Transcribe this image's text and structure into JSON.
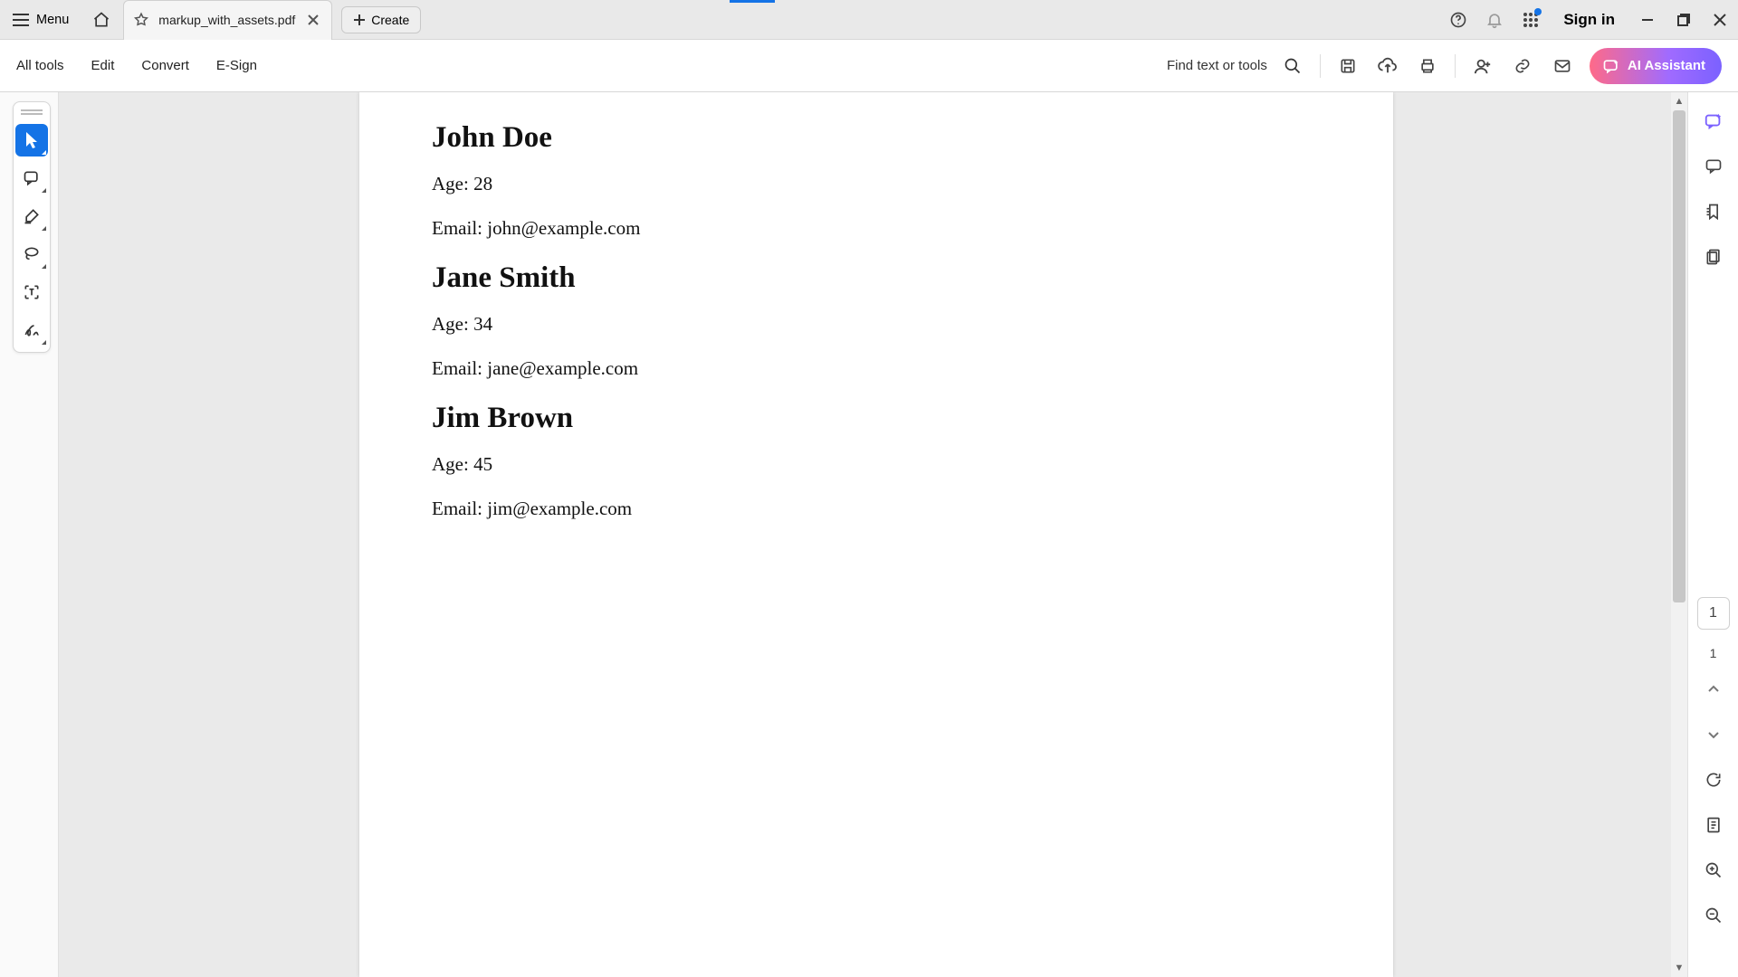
{
  "titlebar": {
    "menu_label": "Menu",
    "file_name": "markup_with_assets.pdf",
    "create_label": "Create",
    "signin_label": "Sign in"
  },
  "toolbar": {
    "all_tools": "All tools",
    "edit": "Edit",
    "convert": "Convert",
    "esign": "E-Sign",
    "find_label": "Find text or tools",
    "ai_label": "AI Assistant"
  },
  "page_nav": {
    "current": "1",
    "total": "1"
  },
  "document": {
    "people": [
      {
        "name": "John Doe",
        "age_line": "Age: 28",
        "email_line": "Email: john@example.com"
      },
      {
        "name": "Jane Smith",
        "age_line": "Age: 34",
        "email_line": "Email: jane@example.com"
      },
      {
        "name": "Jim Brown",
        "age_line": "Age: 45",
        "email_line": "Email: jim@example.com"
      }
    ]
  }
}
